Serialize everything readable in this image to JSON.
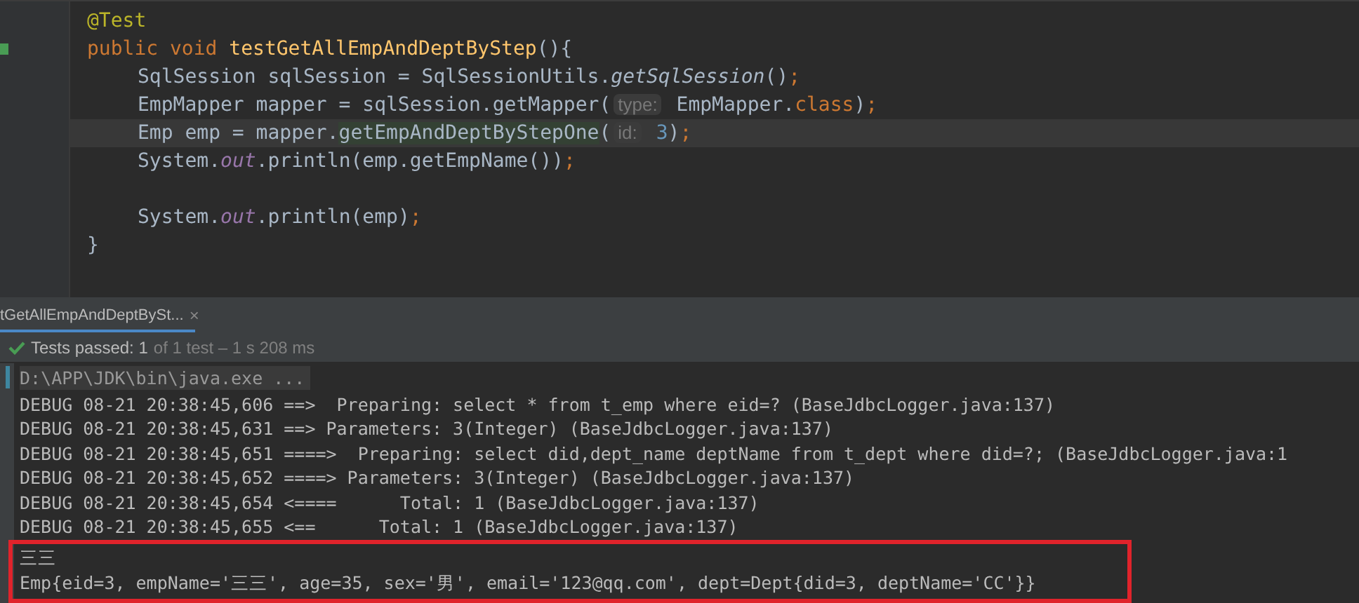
{
  "editor": {
    "lines": [
      {
        "current": false,
        "tokens": [
          {
            "kind": "annotation",
            "text": "@Test"
          }
        ]
      },
      {
        "current": false,
        "tokens": [
          {
            "kind": "keyword",
            "text": "public void "
          },
          {
            "kind": "declaration",
            "text": "testGetAllEmpAndDeptByStep"
          },
          {
            "kind": "plain",
            "text": "(){"
          }
        ],
        "children": [
          {
            "current": false,
            "tokens": [
              {
                "kind": "plain",
                "text": "SqlSession sqlSession = SqlSessionUtils."
              },
              {
                "kind": "static",
                "text": "getSqlSession"
              },
              {
                "kind": "plain",
                "text": "()"
              },
              {
                "kind": "keyword",
                "text": ";"
              }
            ]
          },
          {
            "current": false,
            "tokens": [
              {
                "kind": "plain",
                "text": "EmpMapper mapper = sqlSession.getMapper("
              },
              {
                "kind": "hint",
                "text": "type:"
              },
              {
                "kind": "plain",
                "text": " EmpMapper."
              },
              {
                "kind": "keyword",
                "text": "class"
              },
              {
                "kind": "plain",
                "text": ")"
              },
              {
                "kind": "keyword",
                "text": ";"
              }
            ]
          },
          {
            "current": true,
            "tokens": [
              {
                "kind": "plain",
                "text": "Emp emp = mapper."
              },
              {
                "kind": "usage",
                "text": "getEmpAndDeptByStepOne"
              },
              {
                "kind": "plain",
                "text": "("
              },
              {
                "kind": "hint",
                "text": "id:"
              },
              {
                "kind": "number",
                "text": " 3"
              },
              {
                "kind": "plain",
                "text": ")"
              },
              {
                "kind": "keyword",
                "text": ";"
              }
            ]
          },
          {
            "current": false,
            "tokens": [
              {
                "kind": "plain",
                "text": "System."
              },
              {
                "kind": "field",
                "text": "out"
              },
              {
                "kind": "plain",
                "text": ".println(emp.getEmpName())"
              },
              {
                "kind": "keyword",
                "text": ";"
              }
            ]
          },
          {
            "current": false,
            "blank_before": true,
            "tokens": [
              {
                "kind": "plain",
                "text": "System."
              },
              {
                "kind": "field",
                "text": "out"
              },
              {
                "kind": "plain",
                "text": ".println(emp)"
              },
              {
                "kind": "keyword",
                "text": ";"
              }
            ]
          }
        ]
      },
      {
        "current": false,
        "tokens": [
          {
            "kind": "plain",
            "text": "}"
          }
        ]
      }
    ]
  },
  "run_tab": {
    "label": "tGetAllEmpAndDeptBySt...",
    "close": "×"
  },
  "status": {
    "passed": "Tests passed: 1",
    "rest": "of 1 test – 1 s 208 ms"
  },
  "console": {
    "command": "D:\\APP\\JDK\\bin\\java.exe ...",
    "lines": [
      "DEBUG 08-21 20:38:45,606 ==>  Preparing: select * from t_emp where eid=? (BaseJdbcLogger.java:137)",
      "DEBUG 08-21 20:38:45,631 ==> Parameters: 3(Integer) (BaseJdbcLogger.java:137)",
      "DEBUG 08-21 20:38:45,651 ====>  Preparing: select did,dept_name deptName from t_dept where did=?; (BaseJdbcLogger.java:1",
      "DEBUG 08-21 20:38:45,652 ====> Parameters: 3(Integer) (BaseJdbcLogger.java:137)",
      "DEBUG 08-21 20:38:45,654 <====      Total: 1 (BaseJdbcLogger.java:137)",
      "DEBUG 08-21 20:38:45,655 <==      Total: 1 (BaseJdbcLogger.java:137)"
    ],
    "highlighted": [
      "三三",
      "Emp{eid=3, empName='三三', age=35, sex='男', email='123@qq.com', dept=Dept{did=3, deptName='CC'}}"
    ]
  }
}
